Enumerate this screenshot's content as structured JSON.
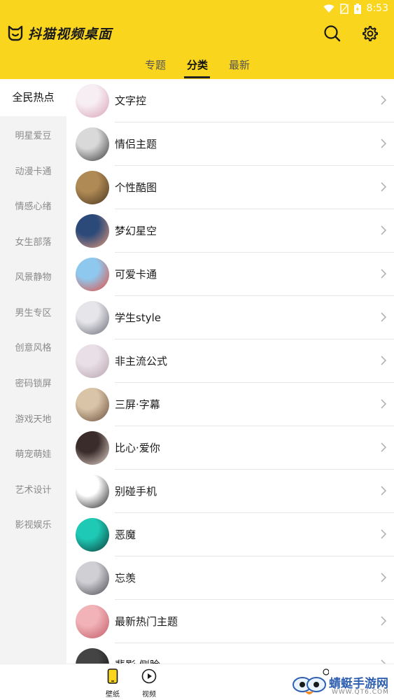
{
  "status": {
    "time": "8:53"
  },
  "app": {
    "title": "抖猫视频桌面"
  },
  "tabs": [
    {
      "label": "专题"
    },
    {
      "label": "分类"
    },
    {
      "label": "最新"
    }
  ],
  "sidebar": {
    "items": [
      {
        "label": "全民热点"
      },
      {
        "label": "明星爱豆"
      },
      {
        "label": "动漫卡通"
      },
      {
        "label": "情感心绪"
      },
      {
        "label": "女生部落"
      },
      {
        "label": "风景静物"
      },
      {
        "label": "男生专区"
      },
      {
        "label": "创意风格"
      },
      {
        "label": "密码锁屏"
      },
      {
        "label": "游戏天地"
      },
      {
        "label": "萌宠萌娃"
      },
      {
        "label": "艺术设计"
      },
      {
        "label": "影视娱乐"
      }
    ]
  },
  "list": {
    "items": [
      {
        "label": "文字控",
        "thumb_colors": [
          "#f7eef3",
          "#d8a1b5"
        ]
      },
      {
        "label": "情侣主题",
        "thumb_colors": [
          "#d9d9d9",
          "#3a3a3a"
        ]
      },
      {
        "label": "个性酷图",
        "thumb_colors": [
          "#b08a55",
          "#4a3520"
        ]
      },
      {
        "label": "梦幻星空",
        "thumb_colors": [
          "#2b4a7a",
          "#e89a7a"
        ]
      },
      {
        "label": "可爱卡通",
        "thumb_colors": [
          "#8fc8ee",
          "#e64a3c"
        ]
      },
      {
        "label": "学生style",
        "thumb_colors": [
          "#e6e6ea",
          "#6a6a78"
        ]
      },
      {
        "label": "非主流公式",
        "thumb_colors": [
          "#e9dfe6",
          "#b7a2ad"
        ]
      },
      {
        "label": "三屏·字幕",
        "thumb_colors": [
          "#d9c4a8",
          "#6b4e3a"
        ]
      },
      {
        "label": "比心·爱你",
        "thumb_colors": [
          "#3a2c2a",
          "#e8d8d0"
        ]
      },
      {
        "label": "别碰手机",
        "thumb_colors": [
          "#ffffff",
          "#222222"
        ]
      },
      {
        "label": "恶魔",
        "thumb_colors": [
          "#1ec9b5",
          "#0b3d3a"
        ]
      },
      {
        "label": "忘羡",
        "thumb_colors": [
          "#cfcfd4",
          "#4a4a52"
        ]
      },
      {
        "label": "最新热门主题",
        "thumb_colors": [
          "#f1b2b8",
          "#c25a64"
        ]
      },
      {
        "label": "悲影·侧脸",
        "thumb_colors": [
          "#444",
          "#111"
        ]
      }
    ]
  },
  "bottom_nav": [
    {
      "label": "壁纸"
    },
    {
      "label": "视频"
    }
  ],
  "watermark": {
    "text": "蜻蜓手游网",
    "url": "WWW.QT6.COM"
  },
  "colors": {
    "accent": "#f9d51d",
    "sidebar_bg": "#f3f3f3"
  }
}
